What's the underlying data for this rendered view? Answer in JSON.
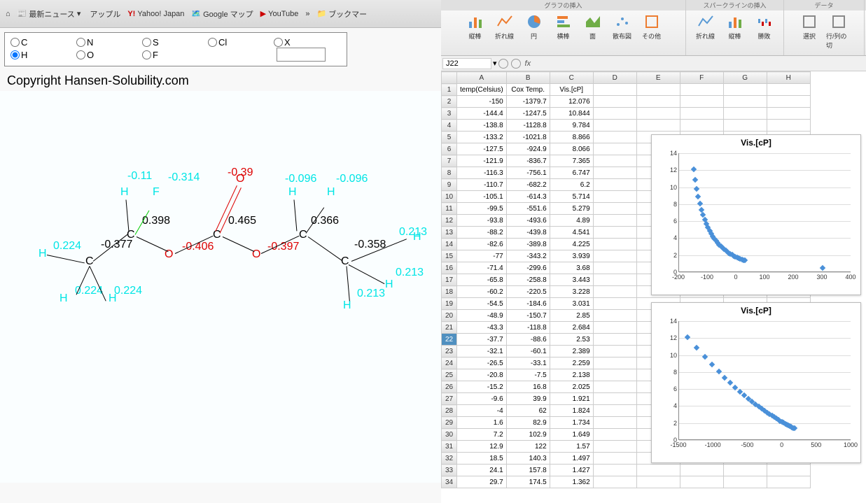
{
  "browser": {
    "bookmarks": [
      "最新ニュース",
      "アップル",
      "Yahoo! Japan",
      "Google マップ",
      "YouTube",
      "ブックマー"
    ]
  },
  "radio": {
    "row1": [
      "C",
      "N",
      "S",
      "Cl",
      "X"
    ],
    "row2": [
      "H",
      "O",
      "F"
    ]
  },
  "copyright": "Copyright Hansen-Solubility.com",
  "molecule": {
    "atoms": {
      "h1": "H",
      "c1": "C",
      "h2": "H",
      "h3": "H",
      "h4": "H",
      "c2": "C",
      "f1": "F",
      "o1": "O",
      "c3": "C",
      "o2": "O",
      "o3": "O",
      "c4": "C",
      "h5": "H",
      "h6": "H",
      "c5": "C",
      "h7": "H",
      "h8": "H",
      "h9": "H"
    },
    "charges": {
      "ch1": "0.224",
      "ch2": "-0.377",
      "ch3": "0.224",
      "ch4": "0.224",
      "ch5": "-0.11",
      "ch6": "0.398",
      "ch7": "-0.314",
      "ch8": "-0.406",
      "ch9": "0.465",
      "ch10": "-0.39",
      "ch11": "-0.397",
      "ch12": "0.366",
      "ch13": "-0.096",
      "ch14": "-0.096",
      "ch15": "-0.358",
      "ch16": "0.213",
      "ch17": "0.213",
      "ch18": "0.213"
    }
  },
  "ribbon": {
    "header_groups": [
      "グラフの挿入",
      "スパークラインの挿入",
      "データ"
    ],
    "groups": {
      "charts": [
        {
          "id": "bar",
          "label": "縦棒"
        },
        {
          "id": "line",
          "label": "折れ線"
        },
        {
          "id": "pie",
          "label": "円"
        },
        {
          "id": "hbar",
          "label": "横棒"
        },
        {
          "id": "area",
          "label": "面"
        },
        {
          "id": "scatter",
          "label": "散布図"
        },
        {
          "id": "other",
          "label": "その他"
        }
      ],
      "spark": [
        {
          "id": "sline",
          "label": "折れ線"
        },
        {
          "id": "sbar",
          "label": "縦棒"
        },
        {
          "id": "swin",
          "label": "勝敗"
        }
      ],
      "data": [
        {
          "id": "select",
          "label": "選択"
        },
        {
          "id": "rowcol",
          "label": "行/列の切"
        }
      ]
    }
  },
  "cellref": {
    "name": "J22"
  },
  "sheet": {
    "cols": [
      "A",
      "B",
      "C",
      "D",
      "E",
      "F",
      "G",
      "H"
    ],
    "headers": [
      "temp(Celsius)",
      "Cox Temp.",
      "Vis.[cP]"
    ],
    "rows": [
      [
        "-150",
        "-1379.7",
        "12.076"
      ],
      [
        "-144.4",
        "-1247.5",
        "10.844"
      ],
      [
        "-138.8",
        "-1128.8",
        "9.784"
      ],
      [
        "-133.2",
        "-1021.8",
        "8.866"
      ],
      [
        "-127.5",
        "-924.9",
        "8.066"
      ],
      [
        "-121.9",
        "-836.7",
        "7.365"
      ],
      [
        "-116.3",
        "-756.1",
        "6.747"
      ],
      [
        "-110.7",
        "-682.2",
        "6.2"
      ],
      [
        "-105.1",
        "-614.3",
        "5.714"
      ],
      [
        "-99.5",
        "-551.6",
        "5.279"
      ],
      [
        "-93.8",
        "-493.6",
        "4.89"
      ],
      [
        "-88.2",
        "-439.8",
        "4.541"
      ],
      [
        "-82.6",
        "-389.8",
        "4.225"
      ],
      [
        "-77",
        "-343.2",
        "3.939"
      ],
      [
        "-71.4",
        "-299.6",
        "3.68"
      ],
      [
        "-65.8",
        "-258.8",
        "3.443"
      ],
      [
        "-60.2",
        "-220.5",
        "3.228"
      ],
      [
        "-54.5",
        "-184.6",
        "3.031"
      ],
      [
        "-48.9",
        "-150.7",
        "2.85"
      ],
      [
        "-43.3",
        "-118.8",
        "2.684"
      ],
      [
        "-37.7",
        "-88.6",
        "2.53"
      ],
      [
        "-32.1",
        "-60.1",
        "2.389"
      ],
      [
        "-26.5",
        "-33.1",
        "2.259"
      ],
      [
        "-20.8",
        "-7.5",
        "2.138"
      ],
      [
        "-15.2",
        "16.8",
        "2.025"
      ],
      [
        "-9.6",
        "39.9",
        "1.921"
      ],
      [
        "-4",
        "62",
        "1.824"
      ],
      [
        "1.6",
        "82.9",
        "1.734"
      ],
      [
        "7.2",
        "102.9",
        "1.649"
      ],
      [
        "12.9",
        "122",
        "1.57"
      ],
      [
        "18.5",
        "140.3",
        "1.497"
      ],
      [
        "24.1",
        "157.8",
        "1.427"
      ],
      [
        "29.7",
        "174.5",
        "1.362"
      ]
    ],
    "selected_row": 22
  },
  "chart_data": [
    {
      "type": "scatter",
      "title": "Vis.[cP]",
      "xlabel": "",
      "ylabel": "",
      "xlim": [
        -200,
        400
      ],
      "ylim": [
        0,
        14
      ],
      "xticks": [
        -200,
        -100,
        0,
        100,
        200,
        300,
        400
      ],
      "yticks": [
        0,
        2,
        4,
        6,
        8,
        10,
        12,
        14
      ],
      "series": [
        {
          "name": "Vis.[cP]",
          "x": [
            -150,
            -144.4,
            -138.8,
            -133.2,
            -127.5,
            -121.9,
            -116.3,
            -110.7,
            -105.1,
            -99.5,
            -93.8,
            -88.2,
            -82.6,
            -77,
            -71.4,
            -65.8,
            -60.2,
            -54.5,
            -48.9,
            -43.3,
            -37.7,
            -32.1,
            -26.5,
            -20.8,
            -15.2,
            -9.6,
            -4,
            1.6,
            7.2,
            12.9,
            18.5,
            24.1,
            29.7,
            300
          ],
          "y": [
            12.076,
            10.844,
            9.784,
            8.866,
            8.066,
            7.365,
            6.747,
            6.2,
            5.714,
            5.279,
            4.89,
            4.541,
            4.225,
            3.939,
            3.68,
            3.443,
            3.228,
            3.031,
            2.85,
            2.684,
            2.53,
            2.389,
            2.259,
            2.138,
            2.025,
            1.921,
            1.824,
            1.734,
            1.649,
            1.57,
            1.497,
            1.427,
            1.362,
            0.5
          ]
        }
      ]
    },
    {
      "type": "scatter",
      "title": "Vis.[cP]",
      "xlabel": "",
      "ylabel": "",
      "xlim": [
        -1500,
        1000
      ],
      "ylim": [
        0,
        14
      ],
      "xticks": [
        -1500,
        -1000,
        -500,
        0,
        500,
        1000
      ],
      "yticks": [
        0,
        2,
        4,
        6,
        8,
        10,
        12,
        14
      ],
      "series": [
        {
          "name": "Vis.[cP]",
          "x": [
            -1379.7,
            -1247.5,
            -1128.8,
            -1021.8,
            -924.9,
            -836.7,
            -756.1,
            -682.2,
            -614.3,
            -551.6,
            -493.6,
            -439.8,
            -389.8,
            -343.2,
            -299.6,
            -258.8,
            -220.5,
            -184.6,
            -150.7,
            -118.8,
            -88.6,
            -60.1,
            -33.1,
            -7.5,
            16.8,
            39.9,
            62,
            82.9,
            102.9,
            122,
            140.3,
            157.8,
            174.5
          ],
          "y": [
            12.076,
            10.844,
            9.784,
            8.866,
            8.066,
            7.365,
            6.747,
            6.2,
            5.714,
            5.279,
            4.89,
            4.541,
            4.225,
            3.939,
            3.68,
            3.443,
            3.228,
            3.031,
            2.85,
            2.684,
            2.53,
            2.389,
            2.259,
            2.138,
            2.025,
            1.921,
            1.824,
            1.734,
            1.649,
            1.57,
            1.497,
            1.427,
            1.362
          ]
        }
      ]
    }
  ]
}
